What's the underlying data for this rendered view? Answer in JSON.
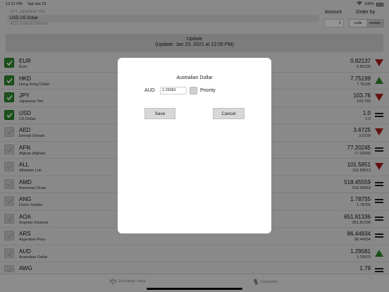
{
  "status": {
    "time": "12:21 PM",
    "date": "Sat Jan 23",
    "battery": "100%"
  },
  "picker": {
    "above": "JPY Japanese Yen",
    "selected": "USD US Dollar",
    "below": "AED Emirati Dirham"
  },
  "amount": {
    "label": "Amount",
    "value": "1"
  },
  "order_by": {
    "label": "Order by",
    "options": [
      "code",
      "country"
    ],
    "selected": "code"
  },
  "update": {
    "title": "Update",
    "subtitle": "(Update: Jan 23, 2021 at 12:05 PM)"
  },
  "colors": {
    "check_on": "#2f8f2f",
    "up": "#2e8b2e",
    "down": "#b01c1c",
    "same": "#222222"
  },
  "rows": [
    {
      "code": "EUR",
      "name": "Euro",
      "rate": "0.82137",
      "inverse": "0.82139",
      "trend": "down",
      "checked": true
    },
    {
      "code": "HKD",
      "name": "Hong Kong Dollar",
      "rate": "7.75199",
      "inverse": "7.75195",
      "trend": "up",
      "checked": true
    },
    {
      "code": "JPY",
      "name": "Japanese Yen",
      "rate": "103.76",
      "inverse": "103.765",
      "trend": "down",
      "checked": true
    },
    {
      "code": "USD",
      "name": "US Dollar",
      "rate": "1.0",
      "inverse": "1.0",
      "trend": "same",
      "checked": true
    },
    {
      "code": "AED",
      "name": "Emirati Dirham",
      "rate": "3.6725",
      "inverse": "3.6729",
      "trend": "down",
      "checked": false
    },
    {
      "code": "AFN",
      "name": "Afghan Afghani",
      "rate": "77.20245",
      "inverse": "77.20245",
      "trend": "same",
      "checked": false
    },
    {
      "code": "ALL",
      "name": "Albanian Lek",
      "rate": "101.5851",
      "inverse": "101.58512",
      "trend": "down",
      "checked": false
    },
    {
      "code": "AMD",
      "name": "Armenian Dram",
      "rate": "518.45559",
      "inverse": "518.45559",
      "trend": "same",
      "checked": false
    },
    {
      "code": "ANG",
      "name": "Dutch Guilder",
      "rate": "1.78755",
      "inverse": "1.78755",
      "trend": "same",
      "checked": false
    },
    {
      "code": "AOA",
      "name": "Angolan Kwanza",
      "rate": "651.81336",
      "inverse": "651.81336",
      "trend": "same",
      "checked": false
    },
    {
      "code": "ARS",
      "name": "Argentine Peso",
      "rate": "86.44934",
      "inverse": "86.44934",
      "trend": "same",
      "checked": false
    },
    {
      "code": "AUD",
      "name": "Australian Dollar",
      "rate": "1.29581",
      "inverse": "1.29579",
      "trend": "up",
      "checked": false
    },
    {
      "code": "AWG",
      "name": "",
      "rate": "1.79",
      "inverse": "",
      "trend": "same",
      "checked": false
    }
  ],
  "tabs": {
    "rates": "Exchange rates",
    "converter": "Converter"
  },
  "dialog": {
    "title": "Australian Dollar",
    "code": "AUD",
    "value": "1.29581",
    "priority_label": "Priority",
    "save": "Save",
    "cancel": "Cancel"
  }
}
